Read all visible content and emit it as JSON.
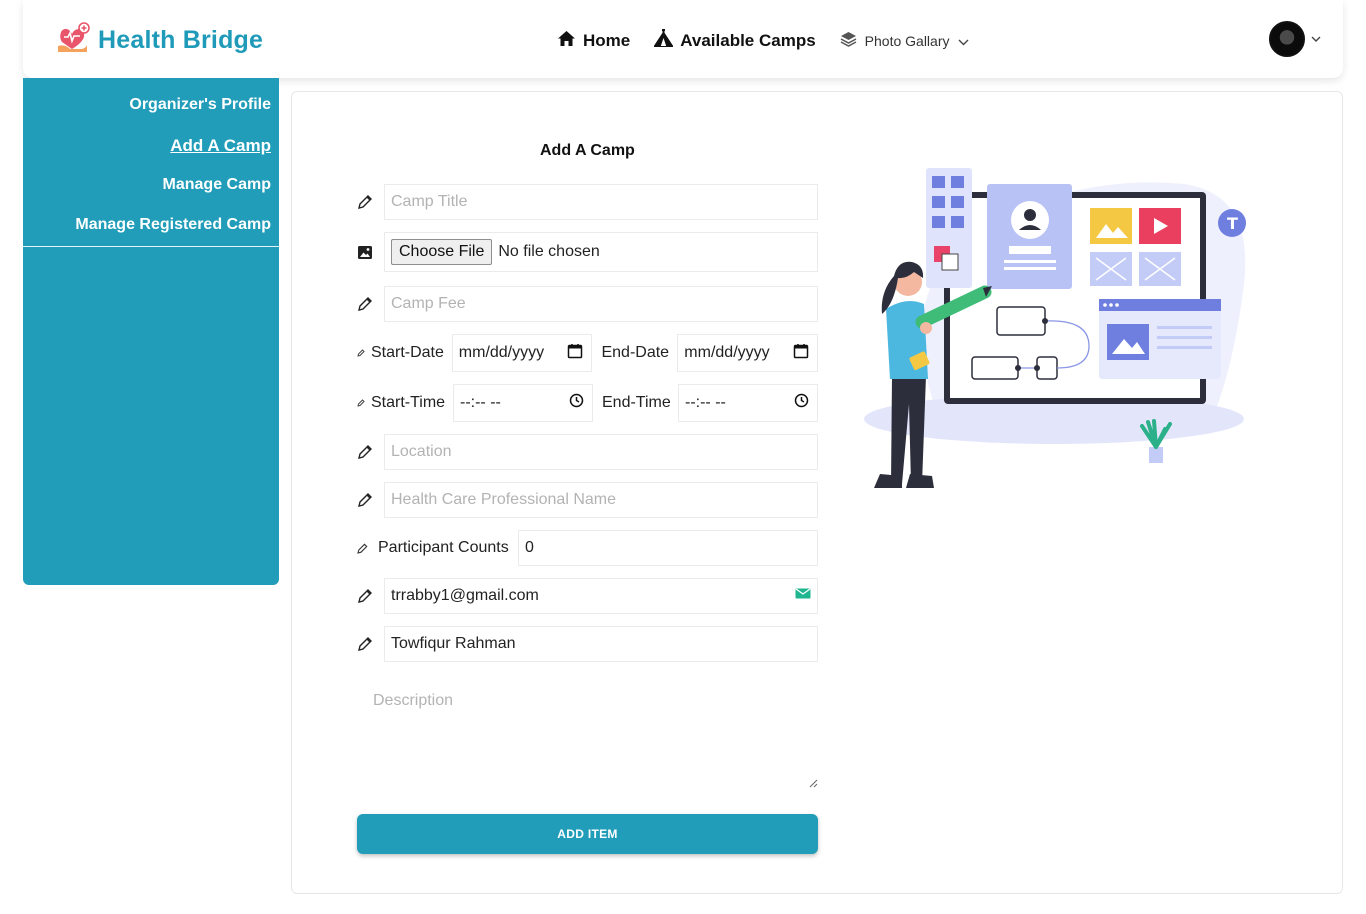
{
  "brand": {
    "name": "Health Bridge",
    "color": "#1f9bb9",
    "icon": "heart-hand-icon"
  },
  "nav": {
    "home": "Home",
    "available_camps": "Available Camps",
    "photo_gallery": "Photo Gallary"
  },
  "sidebar": {
    "items": [
      {
        "label": "Organizer's Profile",
        "active": false
      },
      {
        "label": "Add A Camp",
        "active": true
      },
      {
        "label": "Manage Camp",
        "active": false
      },
      {
        "label": "Manage Registered Camp",
        "active": false
      }
    ]
  },
  "form": {
    "title": "Add A Camp",
    "camp_title_placeholder": "Camp Title",
    "file_button": "Choose File",
    "file_status": "No file chosen",
    "camp_fee_placeholder": "Camp Fee",
    "start_date_label": "Start-Date",
    "start_date_value": "mm/dd/yyyy",
    "end_date_label": "End-Date",
    "end_date_value": "mm/dd/yyyy",
    "start_time_label": "Start-Time",
    "start_time_value": "--:-- --",
    "end_time_label": "End-Time",
    "end_time_value": "--:-- --",
    "location_placeholder": "Location",
    "professional_placeholder": "Health Care Professional Name",
    "participant_label": "Participant Counts",
    "participant_value": "0",
    "email_value": "trrabby1@gmail.com",
    "name_value": "Towfiqur Rahman",
    "description_placeholder": "Description",
    "submit_label": "ADD ITEM"
  },
  "colors": {
    "accent": "#219db9",
    "illustration": "#6f7fe0"
  }
}
